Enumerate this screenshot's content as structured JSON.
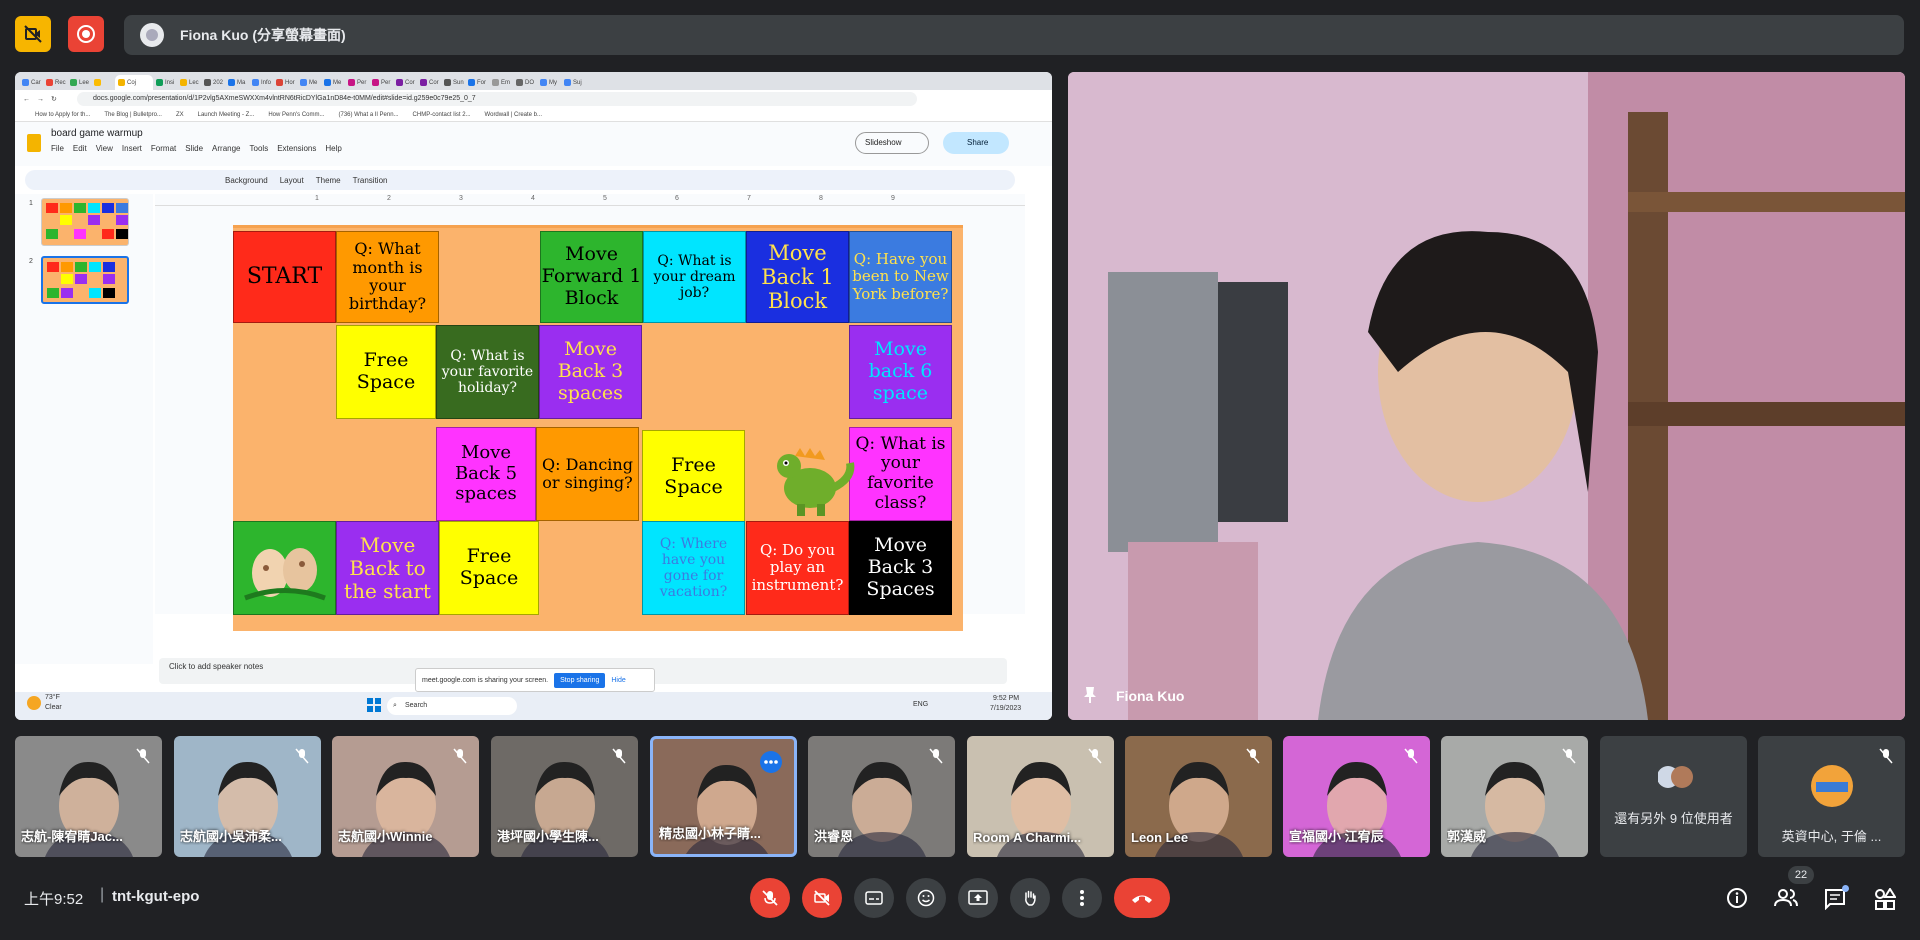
{
  "topbar": {
    "presenter_label": "Fiona Kuo (分享螢幕畫面)"
  },
  "browser": {
    "url": "docs.google.com/presentation/d/1P2vlg5AXmeSWXXm4vlntRN6tRicDYlGa1nD84e-t0MM/edit#slide=id.g259e0c79e25_0_7",
    "tabs": [
      "Car",
      "Rec",
      "Lee",
      "",
      "Coj",
      "Insi",
      "Lec",
      "202",
      "Ma",
      "Info",
      "Hor",
      "Me",
      "Me",
      "Per",
      "Per",
      "Cor",
      "Cor",
      "Sun",
      "For",
      "Em",
      "DO",
      "My",
      "Suj"
    ],
    "bookmarks": [
      "How to Apply for th...",
      "The Blog | Bulletpro...",
      "ZX",
      "Launch Meeting - Z...",
      "How Penn's Comm...",
      "(736) What a Il Penn...",
      "CHMP-contact list 2...",
      "Wordwall | Create b..."
    ]
  },
  "slides_app": {
    "doc_title": "board game warmup",
    "menus": [
      "File",
      "Edit",
      "View",
      "Insert",
      "Format",
      "Slide",
      "Arrange",
      "Tools",
      "Extensions",
      "Help"
    ],
    "slideshow_label": "Slideshow",
    "share_label": "Share",
    "toolbar_items": [
      "Background",
      "Layout",
      "Theme",
      "Transition"
    ],
    "ruler_numbers": [
      "1",
      "2",
      "3",
      "4",
      "5",
      "6",
      "7",
      "8",
      "9"
    ],
    "thumb_numbers": [
      "1",
      "2"
    ],
    "speaker_notes_placeholder": "Click to add speaker notes",
    "sharing_notice": "meet.google.com is sharing your screen.",
    "stop_sharing_label": "Stop sharing",
    "hide_label": "Hide"
  },
  "board": {
    "cells": [
      {
        "id": "start",
        "text": "START",
        "bg": "#ff2a1a",
        "color": "#000000"
      },
      {
        "id": "q-birthday",
        "text": "Q: What month is your birthday?",
        "bg": "#ff9900",
        "color": "#000000"
      },
      {
        "id": "move-forward-1",
        "text": "Move Forward 1 Block",
        "bg": "#2db52d",
        "color": "#000000"
      },
      {
        "id": "q-dream-job",
        "text": "Q: What is your dream job?",
        "bg": "#00e5ff",
        "color": "#000000"
      },
      {
        "id": "move-back-1",
        "text": "Move Back 1 Block",
        "bg": "#1a2fe0",
        "color": "#ffe14d"
      },
      {
        "id": "q-new-york",
        "text": "Q: Have you been to New York before?",
        "bg": "#3b7be0",
        "color": "#ffe14d"
      },
      {
        "id": "free-space-1",
        "text": "Free Space",
        "bg": "#ffff00",
        "color": "#000000"
      },
      {
        "id": "q-holiday",
        "text": "Q: What is your favorite holiday?",
        "bg": "#386b1f",
        "color": "#ffffff"
      },
      {
        "id": "move-back-3a",
        "text": "Move Back 3 spaces",
        "bg": "#9a2ef0",
        "color": "#ffe14d"
      },
      {
        "id": "move-back-6",
        "text": "Move back 6 space",
        "bg": "#9a2ef0",
        "color": "#00e5ff"
      },
      {
        "id": "move-back-5",
        "text": "Move Back 5 spaces",
        "bg": "#ff33ff",
        "color": "#000000"
      },
      {
        "id": "q-dancing",
        "text": "Q: Dancing or singing?",
        "bg": "#ff9900",
        "color": "#000000"
      },
      {
        "id": "free-space-2",
        "text": "Free Space",
        "bg": "#ffff00",
        "color": "#000000"
      },
      {
        "id": "q-class",
        "text": "Q: What is your favorite class?",
        "bg": "#ff33ff",
        "color": "#000000"
      },
      {
        "id": "move-back-start",
        "text": "Move Back to the start",
        "bg": "#9a2ef0",
        "color": "#ffe14d"
      },
      {
        "id": "free-space-3",
        "text": "Free Space",
        "bg": "#ffff00",
        "color": "#000000"
      },
      {
        "id": "q-vacation",
        "text": "Q: Where have you gone for vacation?",
        "bg": "#00e5ff",
        "color": "#3b7be0"
      },
      {
        "id": "q-instrument",
        "text": "Q: Do you play an instrument?",
        "bg": "#ff2a1a",
        "color": "#ffffff"
      },
      {
        "id": "move-back-3b",
        "text": "Move Back 3 Spaces",
        "bg": "#000000",
        "color": "#ffffff"
      },
      {
        "id": "eggs",
        "text": "",
        "bg": "#2db52d",
        "color": "#000000"
      }
    ]
  },
  "taskbar": {
    "weather_temp": "73°F",
    "weather_desc": "Clear",
    "search_label": "Search",
    "lang": "ENG",
    "time": "9:52 PM",
    "date": "7/19/2023"
  },
  "speaker": {
    "name": "Fiona Kuo"
  },
  "participants": [
    {
      "name": "志航-陳宥睛Jac...",
      "bg": "#8a8a8a"
    },
    {
      "name": "志航國小吳沛柔...",
      "bg": "#9fb6c8"
    },
    {
      "name": "志航國小Winnie",
      "bg": "#b59c92"
    },
    {
      "name": "港坪國小學生陳...",
      "bg": "#6e6a66"
    },
    {
      "name": "精忠國小林子睛...",
      "bg": "#8a6a5a"
    },
    {
      "name": "洪睿恩",
      "bg": "#7c7a78"
    },
    {
      "name": "Room A Charmi...",
      "bg": "#c9c0b0"
    },
    {
      "name": "Leon Lee",
      "bg": "#8b6a4c"
    },
    {
      "name": "宣福國小 江宥辰",
      "bg": "#d466d6"
    },
    {
      "name": "郭漢威",
      "bg": "#a8aaa8"
    }
  ],
  "others_tile": {
    "label": "還有另外 9 位使用者"
  },
  "english_tile": {
    "label": "英資中心, 于倫 ..."
  },
  "bottombar": {
    "time": "上午9:52",
    "meeting_code": "tnt-kgut-epo",
    "people_count": "22"
  }
}
